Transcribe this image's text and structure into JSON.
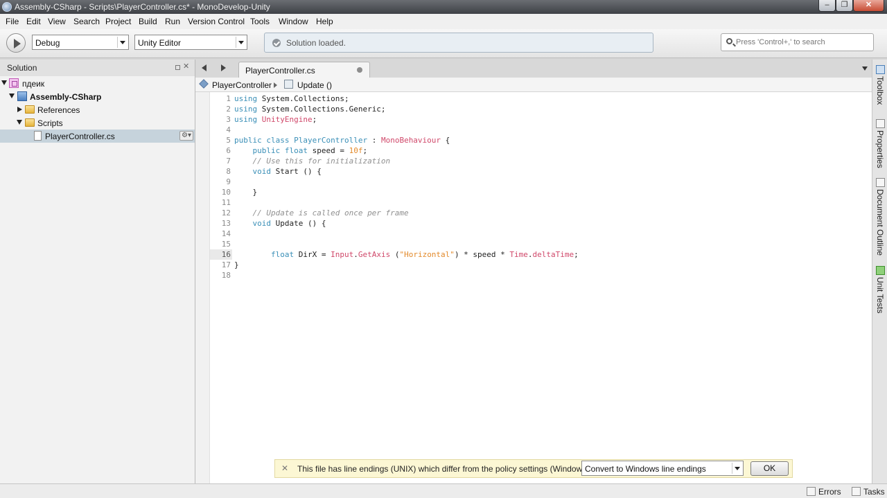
{
  "window": {
    "title": "Assembly-CSharp - Scripts\\PlayerController.cs* - MonoDevelop-Unity",
    "controls": [
      "–",
      "❐",
      "✕"
    ]
  },
  "menu": [
    "File",
    "Edit",
    "View",
    "Search",
    "Project",
    "Build",
    "Run",
    "Version Control",
    "Tools",
    "Window",
    "Help"
  ],
  "toolbar": {
    "configuration": "Debug",
    "target": "Unity Editor",
    "status": "Solution loaded.",
    "search_placeholder": "Press 'Control+,' to search"
  },
  "solution_pad": {
    "title": "Solution",
    "close": "✕",
    "tree": [
      {
        "label": "пдеик",
        "type": "solution"
      },
      {
        "label": "Assembly-CSharp",
        "type": "project"
      },
      {
        "label": "References",
        "type": "folder"
      },
      {
        "label": "Scripts",
        "type": "folder"
      },
      {
        "label": "PlayerController.cs",
        "type": "file",
        "selected": true
      }
    ],
    "file_options": "⚙▾"
  },
  "editor": {
    "tab": "PlayerController.cs",
    "breadcrumb": {
      "class": "PlayerController",
      "method": "Update ()"
    },
    "current_line": 16,
    "lines": [
      {
        "n": "1",
        "tokens": [
          {
            "t": "using",
            "c": "kw"
          },
          {
            "t": " System.Collections;"
          }
        ]
      },
      {
        "n": "2",
        "tokens": [
          {
            "t": "using",
            "c": "kw"
          },
          {
            "t": " System.Collections.Generic;"
          }
        ]
      },
      {
        "n": "3",
        "tokens": [
          {
            "t": "using",
            "c": "kw"
          },
          {
            "t": " "
          },
          {
            "t": "UnityEngine",
            "c": "cls"
          },
          {
            "t": ";"
          }
        ]
      },
      {
        "n": "4",
        "tokens": []
      },
      {
        "n": "5",
        "tokens": [
          {
            "t": "public class",
            "c": "kw"
          },
          {
            "t": " "
          },
          {
            "t": "PlayerController",
            "c": "ty"
          },
          {
            "t": " : "
          },
          {
            "t": "MonoBehaviour",
            "c": "cls"
          },
          {
            "t": " {"
          }
        ]
      },
      {
        "n": "6",
        "tokens": [
          {
            "t": "    "
          },
          {
            "t": "public float",
            "c": "kw"
          },
          {
            "t": " speed = "
          },
          {
            "t": "10f",
            "c": "num"
          },
          {
            "t": ";"
          }
        ]
      },
      {
        "n": "7",
        "tokens": [
          {
            "t": "    "
          },
          {
            "t": "// Use this for initialization",
            "c": "cm"
          }
        ]
      },
      {
        "n": "8",
        "tokens": [
          {
            "t": "    "
          },
          {
            "t": "void",
            "c": "kw"
          },
          {
            "t": " Start () {"
          }
        ]
      },
      {
        "n": "9",
        "tokens": []
      },
      {
        "n": "10",
        "tokens": [
          {
            "t": "    }"
          }
        ]
      },
      {
        "n": "11",
        "tokens": []
      },
      {
        "n": "12",
        "tokens": [
          {
            "t": "    "
          },
          {
            "t": "// Update is called once per frame",
            "c": "cm"
          }
        ]
      },
      {
        "n": "13",
        "tokens": [
          {
            "t": "    "
          },
          {
            "t": "void",
            "c": "kw"
          },
          {
            "t": " Update () {"
          }
        ]
      },
      {
        "n": "14",
        "tokens": []
      },
      {
        "n": "15",
        "tokens": []
      },
      {
        "n": "16",
        "tokens": [
          {
            "t": "        "
          },
          {
            "t": "float",
            "c": "kw"
          },
          {
            "t": " DirX = "
          },
          {
            "t": "Input",
            "c": "cls"
          },
          {
            "t": "."
          },
          {
            "t": "GetAxis",
            "c": "cls"
          },
          {
            "t": " ("
          },
          {
            "t": "\"Horizontal\"",
            "c": "str"
          },
          {
            "t": ") * speed * "
          },
          {
            "t": "Time",
            "c": "cls"
          },
          {
            "t": "."
          },
          {
            "t": "deltaTime",
            "c": "cls"
          },
          {
            "t": ";"
          }
        ]
      },
      {
        "n": "17",
        "tokens": [
          {
            "t": "}"
          }
        ]
      },
      {
        "n": "18",
        "tokens": []
      }
    ]
  },
  "infobar": {
    "close": "✕",
    "message": "This file has line endings (UNIX) which differ from the policy settings (Windows).",
    "option": "Convert to Windows line endings",
    "ok": "OK"
  },
  "right_dock": [
    "Toolbox",
    "Properties",
    "Document Outline",
    "Unit Tests"
  ],
  "statusbar": {
    "errors": "Errors",
    "tasks": "Tasks"
  },
  "colors": {
    "keyword": "#3a8fb7",
    "class": "#d0486a",
    "literal": "#e38a2b",
    "comment": "#8f8f8f",
    "selection": "#c6d3dc"
  }
}
